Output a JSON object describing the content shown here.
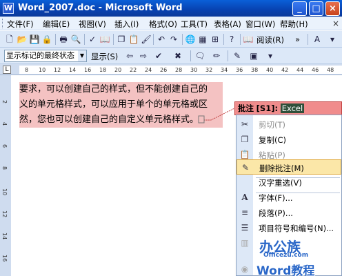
{
  "window": {
    "title": "Word_2007.doc - Microsoft Word",
    "app_icon_letter": "W",
    "controls": {
      "minimize": "_",
      "maximize": "□",
      "close": "×"
    }
  },
  "menu": {
    "items": [
      "文件(F)",
      "编辑(E)",
      "视图(V)",
      "插入(I)",
      "格式(O)",
      "工具(T)",
      "表格(A)",
      "窗口(W)",
      "帮助(H)"
    ],
    "doc_close": "×"
  },
  "toolbar1": {
    "reading_label": "阅读(R)",
    "reading_icon": "book-icon",
    "overflow": "»"
  },
  "toolbar2": {
    "markup_view": "显示标记的最终状态",
    "show_label": "显示(S)"
  },
  "ruler": {
    "ticks": [
      "8",
      "10",
      "12",
      "14",
      "16",
      "18",
      "20",
      "22",
      "24",
      "26",
      "28",
      "30",
      "32",
      "34",
      "36",
      "38",
      "40",
      "42",
      "44",
      "46",
      "48"
    ]
  },
  "vruler": {
    "ticks": [
      "2",
      "4",
      "6",
      "8",
      "10",
      "12",
      "14",
      "16"
    ]
  },
  "document": {
    "lines": [
      "要求，可以创建自己的样式，但不能创建自己的",
      "义的单元格样式，可以应用于单个的单元格或区",
      "然，您也可以创建自己的自定义单元格样式。"
    ]
  },
  "comment": {
    "label": "批注",
    "id": "[S1]:",
    "selected_text": "Excel"
  },
  "context_menu": {
    "items": [
      {
        "label": "剪切(T)",
        "icon": "scissors-icon",
        "glyph": "✂",
        "disabled": true
      },
      {
        "label": "复制(C)",
        "icon": "copy-icon",
        "glyph": "❐",
        "disabled": false
      },
      {
        "label": "粘贴(P)",
        "icon": "paste-icon",
        "glyph": "📋",
        "disabled": true
      },
      {
        "label": "删除批注(M)",
        "icon": "delete-comment-icon",
        "glyph": "✎",
        "selected": true
      },
      {
        "label": "汉字重选(V)",
        "icon": "",
        "glyph": ""
      },
      {
        "label": "字体(F)...",
        "icon": "font-icon",
        "glyph": "A"
      },
      {
        "label": "段落(P)...",
        "icon": "paragraph-icon",
        "glyph": "≡"
      },
      {
        "label": "项目符号和编号(N)...",
        "icon": "bullets-icon",
        "glyph": "☰"
      }
    ]
  },
  "watermark": {
    "line1": "办公族",
    "line2": "Officezu.com",
    "line3": "Word教程"
  },
  "colors": {
    "title_bar": "#0a5fd8",
    "comment_highlight": "#f4c2c2",
    "balloon": "#f08c8c",
    "menu_selected": "#fbe7a8"
  }
}
